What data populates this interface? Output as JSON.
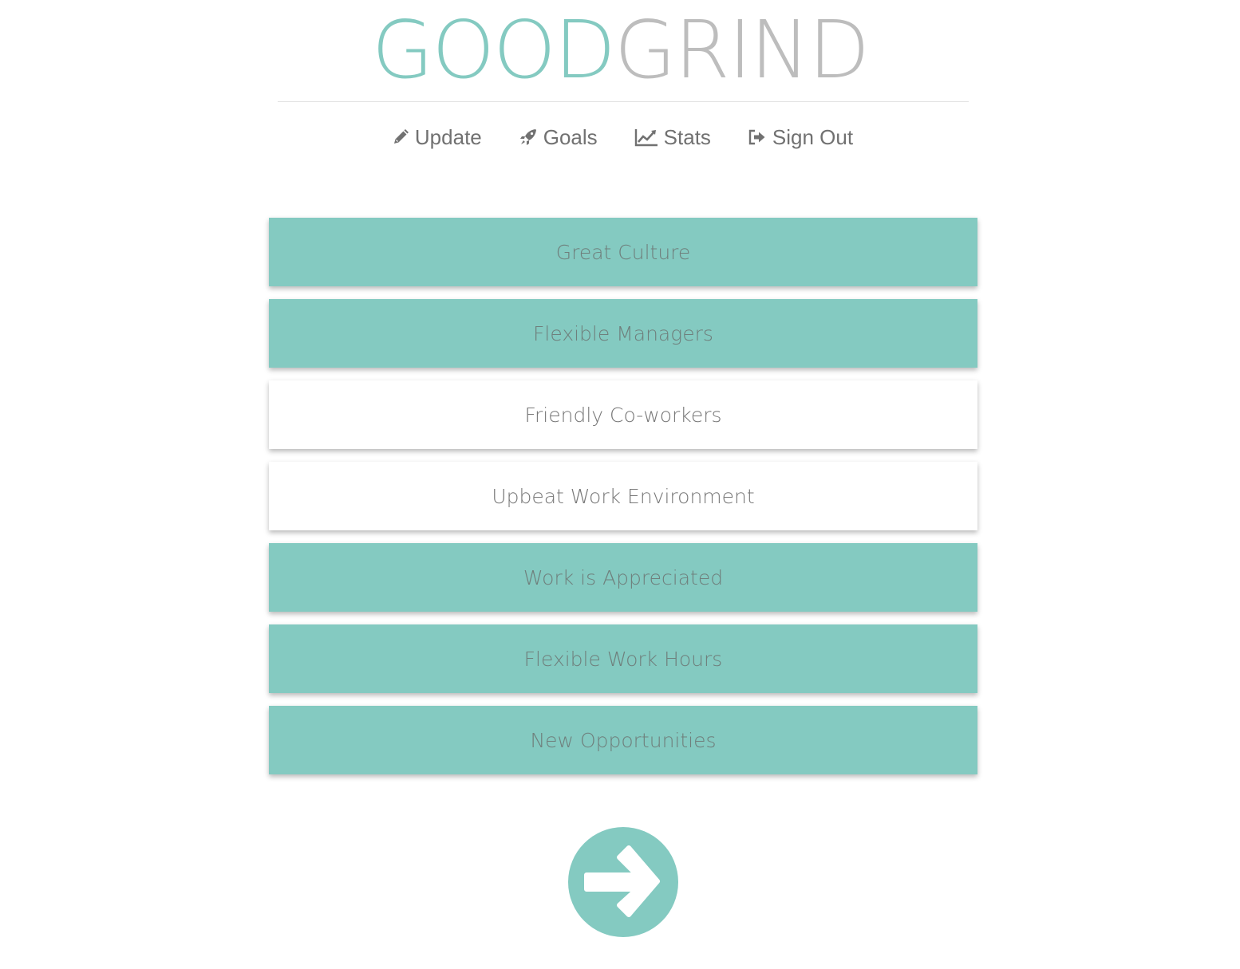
{
  "logo": {
    "part1": "GOOD",
    "part2": "GRIND"
  },
  "nav": {
    "items": [
      {
        "label": "Update",
        "icon": "pencil-icon"
      },
      {
        "label": "Goals",
        "icon": "rocket-icon"
      },
      {
        "label": "Stats",
        "icon": "line-chart-icon"
      },
      {
        "label": "Sign Out",
        "icon": "sign-out-icon"
      }
    ]
  },
  "options": [
    {
      "label": "Great Culture",
      "selected": true
    },
    {
      "label": "Flexible Managers",
      "selected": true
    },
    {
      "label": "Friendly Co-workers",
      "selected": false
    },
    {
      "label": "Upbeat Work Environment",
      "selected": false
    },
    {
      "label": "Work is Appreciated",
      "selected": true
    },
    {
      "label": "Flexible Work Hours",
      "selected": true
    },
    {
      "label": "New Opportunities",
      "selected": true
    }
  ],
  "next_button": {
    "icon": "arrow-right-icon"
  },
  "colors": {
    "accent": "#84cac1",
    "logo_secondary": "#bdbdbd",
    "text": "#777777",
    "nav_text": "#717171"
  }
}
